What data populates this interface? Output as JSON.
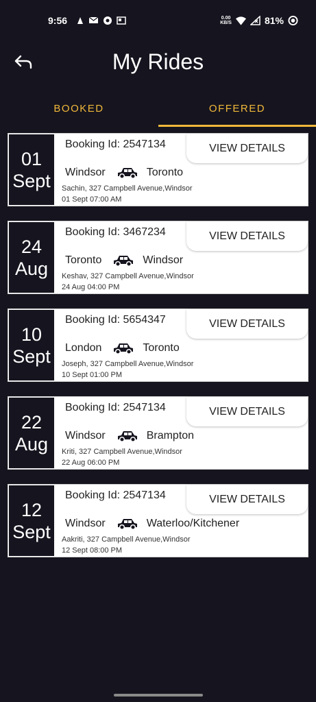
{
  "status_bar": {
    "time": "9:56",
    "net_speed_value": "0.00",
    "net_speed_unit": "KB/S",
    "battery": "81%"
  },
  "header": {
    "title": "My Rides"
  },
  "tabs": [
    {
      "label": "BOOKED",
      "active": false
    },
    {
      "label": "OFFERED",
      "active": true
    }
  ],
  "colors": {
    "background": "#16151f",
    "accent": "#f2b83a",
    "card": "#ffffff"
  },
  "rides": [
    {
      "day": "01",
      "month": "Sept",
      "booking_label": "Booking Id: 2547134",
      "action": "VIEW DETAILS",
      "from": "Windsor",
      "to": "Toronto",
      "passenger": "Sachin, 327 Campbell Avenue,Windsor",
      "datetime": "01 Sept 07:00 AM"
    },
    {
      "day": "24",
      "month": "Aug",
      "booking_label": "Booking Id: 3467234",
      "action": "VIEW DETAILS",
      "from": "Toronto",
      "to": "Windsor",
      "passenger": "Keshav, 327 Campbell Avenue,Windsor",
      "datetime": "24 Aug 04:00 PM"
    },
    {
      "day": "10",
      "month": "Sept",
      "booking_label": "Booking Id: 5654347",
      "action": "VIEW DETAILS",
      "from": "London",
      "to": "Toronto",
      "passenger": "Joseph, 327 Campbell Avenue,Windsor",
      "datetime": "10 Sept 01:00 PM"
    },
    {
      "day": "22",
      "month": "Aug",
      "booking_label": "Booking Id: 2547134",
      "action": "VIEW DETAILS",
      "from": "Windsor",
      "to": "Brampton",
      "passenger": "Kriti, 327 Campbell Avenue,Windsor",
      "datetime": "22 Aug 06:00 PM"
    },
    {
      "day": "12",
      "month": "Sept",
      "booking_label": "Booking Id: 2547134",
      "action": "VIEW DETAILS",
      "from": "Windsor",
      "to": "Waterloo/Kitchener",
      "passenger": "Aakriti, 327 Campbell Avenue,Windsor",
      "datetime": "12 Sept 08:00 PM"
    }
  ]
}
